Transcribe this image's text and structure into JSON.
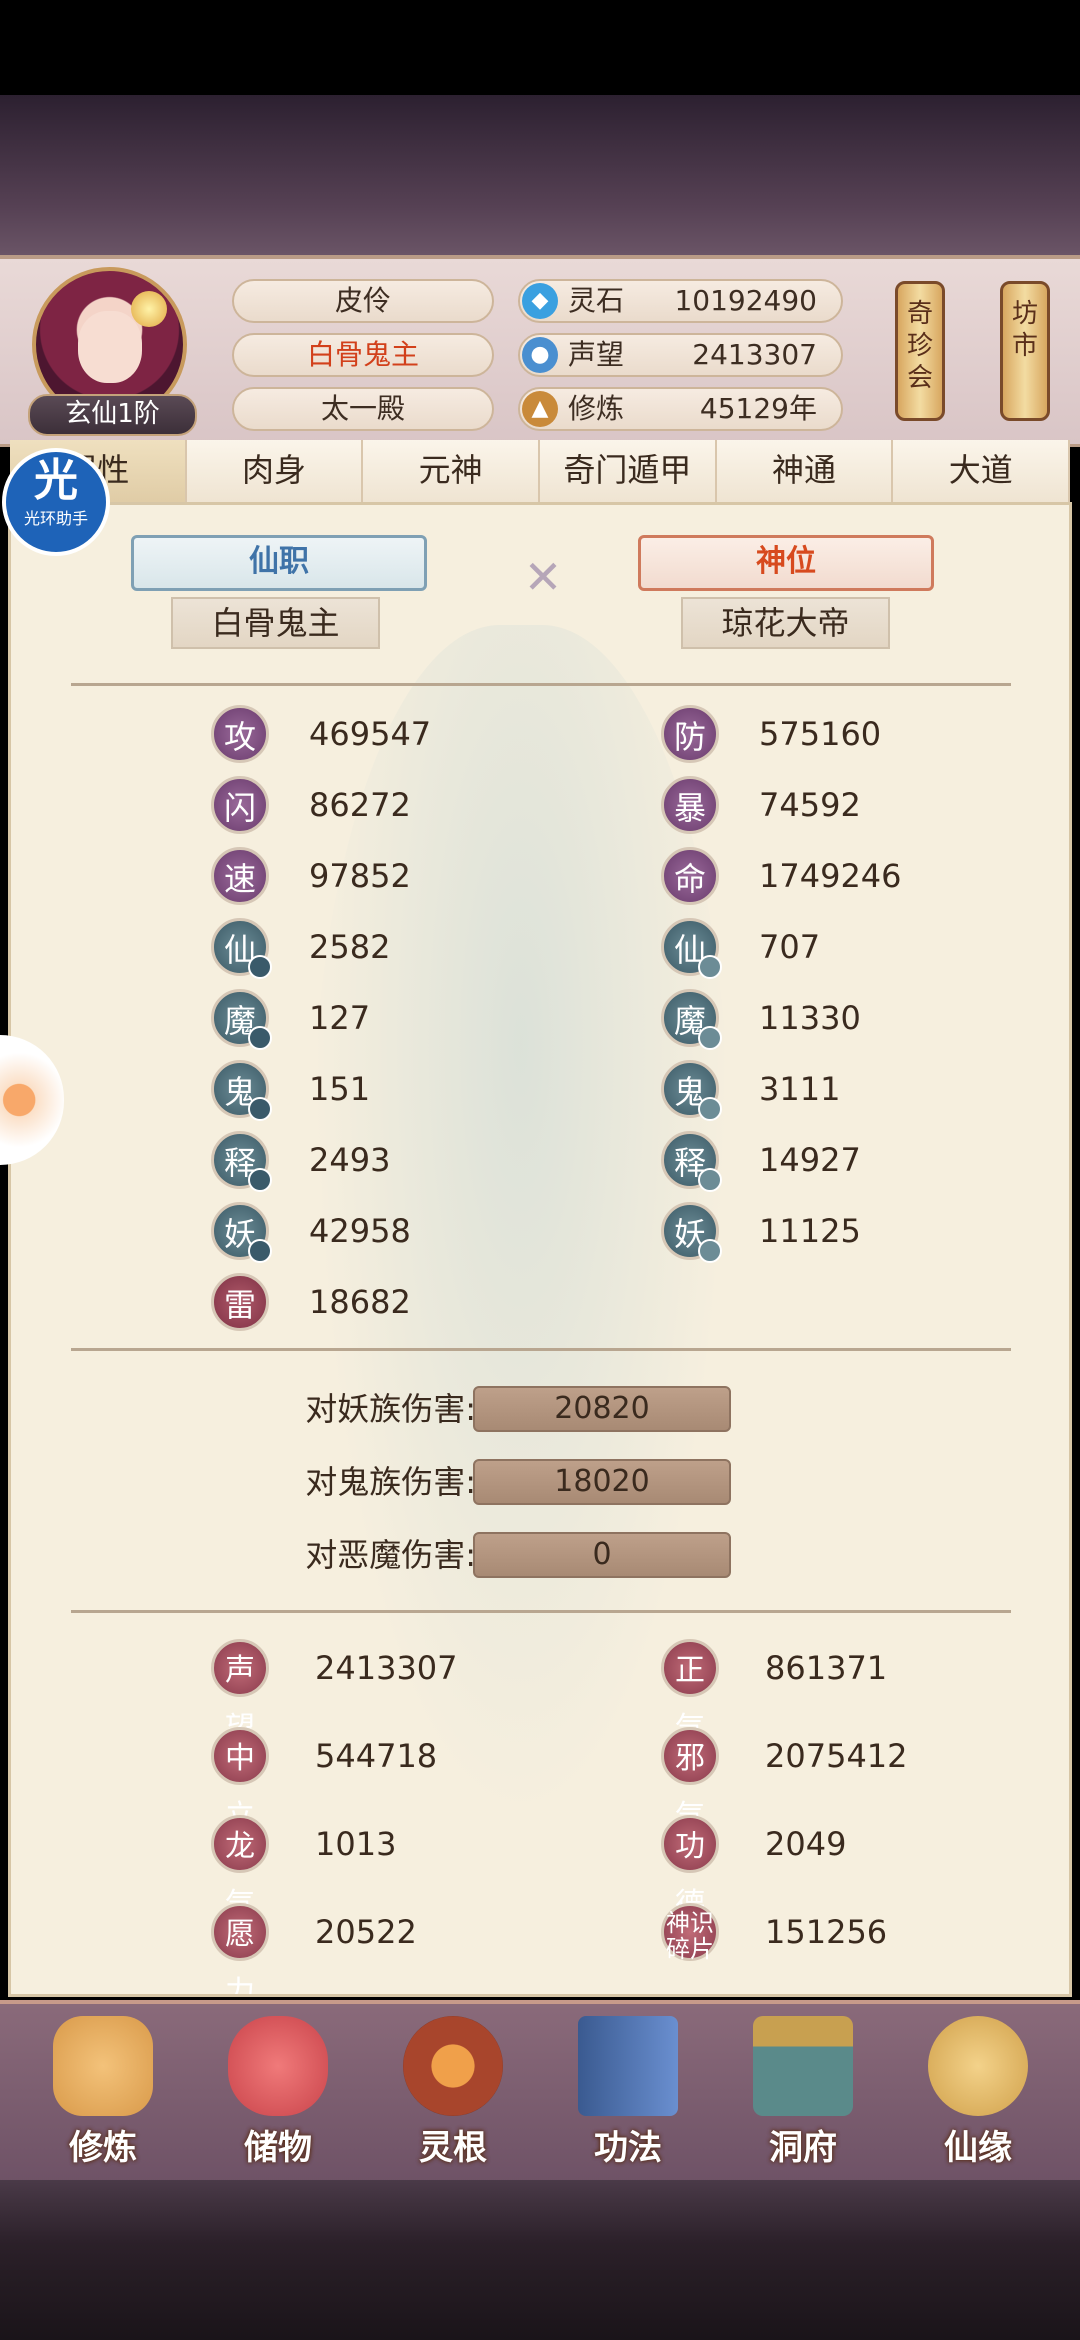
{
  "player": {
    "rank": "玄仙1阶",
    "name": "皮伶",
    "title": "白骨鬼主",
    "faction": "太一殿"
  },
  "resources": [
    {
      "label": "灵石",
      "value": "10192490",
      "icon": "spirit-stone-icon",
      "color": "#3aa0e0"
    },
    {
      "label": "声望",
      "value": "2413307",
      "icon": "reputation-drop-icon",
      "color": "#4a8fd0"
    },
    {
      "label": "修炼",
      "value": "45129年",
      "icon": "meditation-icon",
      "color": "#c98a3a"
    }
  ],
  "side_buttons": {
    "treasure": "奇珍会",
    "market": "坊市"
  },
  "tabs": [
    "属性",
    "肉身",
    "元神",
    "奇门遁甲",
    "神通",
    "大道"
  ],
  "overlay": {
    "badge_char": "光",
    "badge_text": "光环助手"
  },
  "titles": {
    "left_header": "仙职",
    "left_value": "白骨鬼主",
    "right_header": "神位",
    "right_value": "琼花大帝"
  },
  "stats_left": [
    {
      "char": "攻",
      "value": "469547",
      "color": "purple"
    },
    {
      "char": "闪",
      "value": "86272",
      "color": "purple"
    },
    {
      "char": "速",
      "value": "97852",
      "color": "purple"
    },
    {
      "char": "仙",
      "value": "2582",
      "color": "teal"
    },
    {
      "char": "魔",
      "value": "127",
      "color": "teal"
    },
    {
      "char": "鬼",
      "value": "151",
      "color": "teal"
    },
    {
      "char": "释",
      "value": "2493",
      "color": "teal"
    },
    {
      "char": "妖",
      "value": "42958",
      "color": "teal"
    },
    {
      "char": "雷",
      "value": "18682",
      "color": "red"
    }
  ],
  "stats_right": [
    {
      "char": "防",
      "value": "575160",
      "color": "purple"
    },
    {
      "char": "暴",
      "value": "74592",
      "color": "purple"
    },
    {
      "char": "命",
      "value": "1749246",
      "color": "purple"
    },
    {
      "char": "仙",
      "value": "707",
      "color": "teal"
    },
    {
      "char": "魔",
      "value": "11330",
      "color": "teal"
    },
    {
      "char": "鬼",
      "value": "3111",
      "color": "teal"
    },
    {
      "char": "释",
      "value": "14927",
      "color": "teal"
    },
    {
      "char": "妖",
      "value": "11125",
      "color": "teal"
    }
  ],
  "damage": [
    {
      "label": "对妖族伤害:",
      "value": "20820"
    },
    {
      "label": "对鬼族伤害:",
      "value": "18020"
    },
    {
      "label": "对恶魔伤害:",
      "value": "0"
    }
  ],
  "virtues_left": [
    {
      "char": "声望",
      "value": "2413307"
    },
    {
      "char": "中立",
      "value": "544718"
    },
    {
      "char": "龙气",
      "value": "1013"
    },
    {
      "char": "愿力",
      "value": "20522"
    }
  ],
  "virtues_right": [
    {
      "char": "正气",
      "value": "861371"
    },
    {
      "char": "邪气",
      "value": "2075412"
    },
    {
      "char": "功德",
      "value": "2049"
    },
    {
      "char": "神识碎片",
      "value": "151256"
    }
  ],
  "nav": [
    {
      "label": "修炼",
      "icon": "cultivate-icon",
      "color": "#d99a4a"
    },
    {
      "label": "储物",
      "icon": "storage-bag-icon",
      "color": "#c9434a"
    },
    {
      "label": "灵根",
      "icon": "spirit-root-icon",
      "color": "#a8452c"
    },
    {
      "label": "功法",
      "icon": "technique-book-icon",
      "color": "#4a6fb0"
    },
    {
      "label": "洞府",
      "icon": "cave-dwelling-icon",
      "color": "#5a8a8a"
    },
    {
      "label": "仙缘",
      "icon": "gourd-icon",
      "color": "#d0a04a"
    }
  ]
}
